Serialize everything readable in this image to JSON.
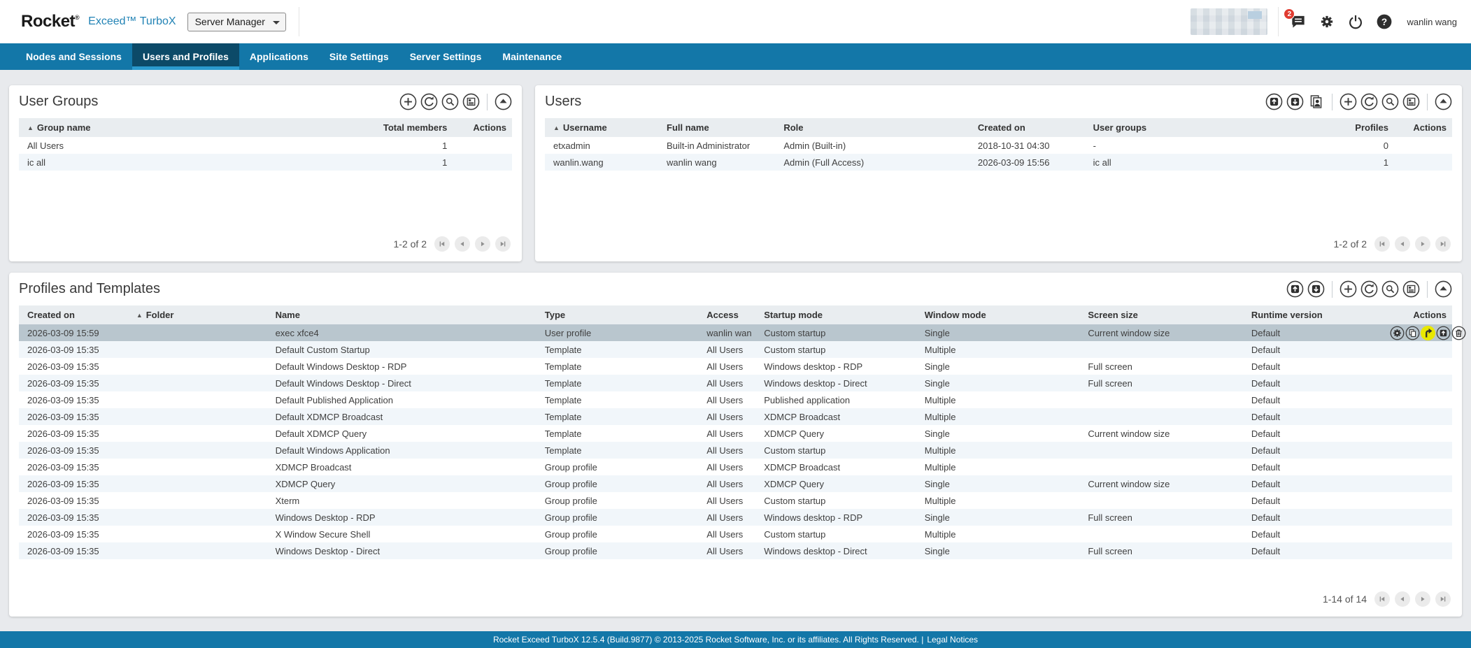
{
  "header": {
    "logo_rocket": "Rocket",
    "logo_reg": "®",
    "logo_product": "Exceed™ TurboX",
    "app_select": {
      "value": "Server Manager"
    },
    "notifications_badge": "2",
    "username": "wanlin wang"
  },
  "nav": {
    "items": [
      {
        "label": "Nodes and Sessions",
        "active": false
      },
      {
        "label": "Users and Profiles",
        "active": true
      },
      {
        "label": "Applications",
        "active": false
      },
      {
        "label": "Site Settings",
        "active": false
      },
      {
        "label": "Server Settings",
        "active": false
      },
      {
        "label": "Maintenance",
        "active": false
      }
    ]
  },
  "user_groups_panel": {
    "title": "User Groups",
    "toolbar": [
      "add",
      "refresh",
      "search",
      "details",
      "sep",
      "collapse"
    ],
    "columns": [
      {
        "label": "Group name",
        "sorted": true
      },
      {
        "label": "Total members"
      },
      {
        "label": "Actions"
      }
    ],
    "rows": [
      [
        "All Users",
        "1",
        ""
      ],
      [
        "ic all",
        "1",
        ""
      ]
    ],
    "pagination": {
      "label": "1-2 of 2"
    }
  },
  "users_panel": {
    "title": "Users",
    "toolbar": [
      "upload",
      "download",
      "import-users",
      "sep",
      "add",
      "refresh",
      "search",
      "details",
      "sep",
      "collapse"
    ],
    "columns": [
      {
        "label": "Username",
        "sorted": true
      },
      {
        "label": "Full name"
      },
      {
        "label": "Role"
      },
      {
        "label": "Created on"
      },
      {
        "label": "User groups"
      },
      {
        "label": "Profiles"
      },
      {
        "label": "Actions"
      }
    ],
    "rows": [
      [
        "etxadmin",
        "Built-in Administrator",
        "Admin (Built-in)",
        "2018-10-31 04:30",
        "-",
        "0",
        ""
      ],
      [
        "wanlin.wang",
        "wanlin wang",
        "Admin (Full Access)",
        "2026-03-09 15:56",
        "ic all",
        "1",
        ""
      ]
    ],
    "pagination": {
      "label": "1-2 of 2"
    }
  },
  "profiles_panel": {
    "title": "Profiles and Templates",
    "toolbar": [
      "upload",
      "download",
      "sep",
      "add",
      "refresh",
      "search",
      "details",
      "sep",
      "collapse"
    ],
    "columns": [
      {
        "label": "Created on"
      },
      {
        "label": "Folder",
        "sorted": true
      },
      {
        "label": "Name"
      },
      {
        "label": "Type"
      },
      {
        "label": "Access"
      },
      {
        "label": "Startup mode"
      },
      {
        "label": "Window mode"
      },
      {
        "label": "Screen size"
      },
      {
        "label": "Runtime version"
      },
      {
        "label": "Actions"
      }
    ],
    "selected_row": 0,
    "selected_row_actions": [
      "settings",
      "copy",
      "launch",
      "export",
      "delete"
    ],
    "highlighted_action": "launch",
    "rows": [
      [
        "2026-03-09 15:59",
        "",
        "exec xfce4",
        "User profile",
        "wanlin wan",
        "Custom startup",
        "Single",
        "Current window size",
        "Default",
        ""
      ],
      [
        "2026-03-09 15:35",
        "",
        "Default Custom Startup",
        "Template",
        "All Users",
        "Custom startup",
        "Multiple",
        "",
        "Default",
        ""
      ],
      [
        "2026-03-09 15:35",
        "",
        "Default Windows Desktop - RDP",
        "Template",
        "All Users",
        "Windows desktop - RDP",
        "Single",
        "Full screen",
        "Default",
        ""
      ],
      [
        "2026-03-09 15:35",
        "",
        "Default Windows Desktop - Direct",
        "Template",
        "All Users",
        "Windows desktop - Direct",
        "Single",
        "Full screen",
        "Default",
        ""
      ],
      [
        "2026-03-09 15:35",
        "",
        "Default Published Application",
        "Template",
        "All Users",
        "Published application",
        "Multiple",
        "",
        "Default",
        ""
      ],
      [
        "2026-03-09 15:35",
        "",
        "Default XDMCP Broadcast",
        "Template",
        "All Users",
        "XDMCP Broadcast",
        "Multiple",
        "",
        "Default",
        ""
      ],
      [
        "2026-03-09 15:35",
        "",
        "Default XDMCP Query",
        "Template",
        "All Users",
        "XDMCP Query",
        "Single",
        "Current window size",
        "Default",
        ""
      ],
      [
        "2026-03-09 15:35",
        "",
        "Default Windows Application",
        "Template",
        "All Users",
        "Custom startup",
        "Multiple",
        "",
        "Default",
        ""
      ],
      [
        "2026-03-09 15:35",
        "",
        "XDMCP Broadcast",
        "Group profile",
        "All Users",
        "XDMCP Broadcast",
        "Multiple",
        "",
        "Default",
        ""
      ],
      [
        "2026-03-09 15:35",
        "",
        "XDMCP Query",
        "Group profile",
        "All Users",
        "XDMCP Query",
        "Single",
        "Current window size",
        "Default",
        ""
      ],
      [
        "2026-03-09 15:35",
        "",
        "Xterm",
        "Group profile",
        "All Users",
        "Custom startup",
        "Multiple",
        "",
        "Default",
        ""
      ],
      [
        "2026-03-09 15:35",
        "",
        "Windows Desktop - RDP",
        "Group profile",
        "All Users",
        "Windows desktop - RDP",
        "Single",
        "Full screen",
        "Default",
        ""
      ],
      [
        "2026-03-09 15:35",
        "",
        "X Window Secure Shell",
        "Group profile",
        "All Users",
        "Custom startup",
        "Multiple",
        "",
        "Default",
        ""
      ],
      [
        "2026-03-09 15:35",
        "",
        "Windows Desktop - Direct",
        "Group profile",
        "All Users",
        "Windows desktop - Direct",
        "Single",
        "Full screen",
        "Default",
        ""
      ]
    ],
    "pagination": {
      "label": "1-14 of 14"
    }
  },
  "footer": {
    "text": "Rocket Exceed TurboX 12.5.4 (Build.9877) © 2013-2025 Rocket Software, Inc. or its affiliates. All Rights Reserved. |",
    "legal_link": "Legal Notices"
  },
  "colors": {
    "nav_blue": "#1377a8",
    "active_tab": "#0c4a68",
    "active_tab_underline": "#2b9ace",
    "selected_row": "#b9c6ce",
    "highlight_yellow": "#e9e800",
    "badge_red": "#e03c31"
  }
}
